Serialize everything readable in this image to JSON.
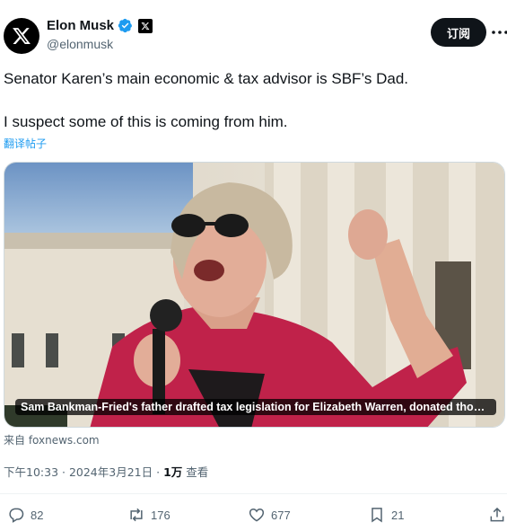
{
  "author": {
    "name": "Elon Musk",
    "handle": "@elonmusk"
  },
  "subscribe_label": "订阅",
  "tweet": {
    "line1": "Senator Karen’s main economic & tax advisor is SBF’s Dad.",
    "line2": "I suspect some of this is coming from him."
  },
  "translate_label": "翻译帖子",
  "media": {
    "caption": "Sam Bankman-Fried's father drafted tax legislation for Elizabeth Warren, donated thous...",
    "source": "来自 foxnews.com"
  },
  "meta": {
    "timestamp": "下午10:33 · 2024年3月21日 · ",
    "views_count": "1万",
    "views_label": " 查看"
  },
  "actions": {
    "replies": "82",
    "reposts": "176",
    "likes": "677",
    "bookmarks": "21"
  },
  "colors": {
    "verified": "#1d9bf0",
    "link": "#1d9bf0",
    "muted": "#536471",
    "button_bg": "#0f1419"
  },
  "icons": [
    "x-logo-icon",
    "verified-badge-icon",
    "x-badge-icon",
    "more-icon",
    "reply-icon",
    "repost-icon",
    "like-icon",
    "bookmark-icon",
    "share-icon"
  ]
}
